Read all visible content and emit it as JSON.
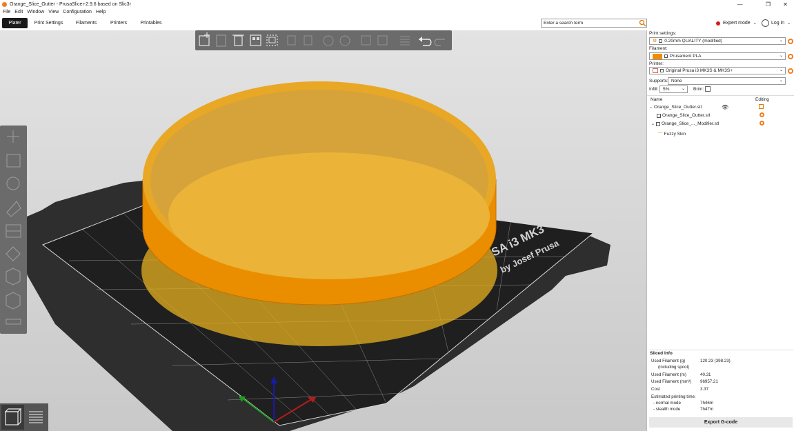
{
  "window": {
    "title": "Orange_Slice_Outter - PrusaSlicer-2.9.6 based on Slic3r",
    "controls": [
      "—",
      "❐",
      "✕"
    ]
  },
  "menu": [
    "File",
    "Edit",
    "Window",
    "View",
    "Configuration",
    "Help"
  ],
  "tabs": [
    "Plater",
    "Print Settings",
    "Filaments",
    "Printers",
    "Printables"
  ],
  "search": {
    "placeholder": "Enter a search term"
  },
  "mode": {
    "label": "Expert mode",
    "color": "#d61a1a"
  },
  "login": {
    "label": "Log in"
  },
  "bed": {
    "brand_text_1": "SA i3 MK3",
    "brand_text_2": "by Josef Prusa"
  },
  "sidebar": {
    "print_settings_label": "Print settings:",
    "print_settings_value": "0.20mm QUALITY (modified)",
    "filament_label": "Filament:",
    "filament_value": "Prusament PLA",
    "filament_color": "#f08c00",
    "printer_label": "Printer:",
    "printer_value": "Original Prusa i3 MK3S & MK3S+",
    "supports_label": "Supports:",
    "supports_value": "None",
    "infill_label": "Infill:",
    "infill_value": "5%",
    "brim_label": "Brim:",
    "col_name": "Name",
    "col_editing": "Editing",
    "objects": [
      {
        "name": "Orange_Slice_Outter.stl"
      },
      {
        "name": "Orange_Slice_Outter.stl"
      },
      {
        "name": "Orange_Slice_..._Modifier.stl"
      },
      {
        "name": "Fuzzy Skin"
      }
    ]
  },
  "sliced_info": {
    "title": "Sliced Info",
    "rows": [
      {
        "key": "Used Filament (g)",
        "value": "120.23 (398.23)"
      },
      {
        "key": "(including spool)",
        "value": ""
      },
      {
        "key": "Used Filament (m)",
        "value": "40.31"
      },
      {
        "key": "Used Filament (mm³)",
        "value": "96957.21"
      },
      {
        "key": "Cost",
        "value": "3.37"
      },
      {
        "key": "Estimated printing time:",
        "value": ""
      },
      {
        "key": "- normal mode",
        "value": "7h46m"
      },
      {
        "key": "- stealth mode",
        "value": "7h47m"
      }
    ]
  },
  "export_label": "Export G-code",
  "colors": {
    "accent": "#f27c1e",
    "object_orange": "#f39200"
  }
}
